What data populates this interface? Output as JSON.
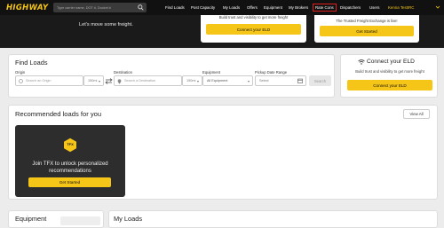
{
  "nav": {
    "logo": "HIGHWAY",
    "search_placeholder": "Type carrier name, DOT #, Docket #",
    "links": [
      "Find Loads",
      "Post Capacity",
      "My Loads",
      "Offers",
      "Equipment",
      "My Brokers",
      "Rate Cons",
      "Dispatchers",
      "Users"
    ],
    "user": "Kenna TestIRC"
  },
  "hero": {
    "tagline": "Let's move some freight."
  },
  "hero_cards": [
    {
      "text": "Build trust and visibility to get more freight",
      "button": "Connect your ELD"
    },
    {
      "text": "The Trusted Freight Exchange is live!",
      "button": "Get Started"
    }
  ],
  "find_loads": {
    "title": "Find Loads",
    "origin": {
      "label": "Origin",
      "placeholder": "Search an Origin",
      "radius": "150mi"
    },
    "destination": {
      "label": "Destination",
      "placeholder": "Search a Destination",
      "radius": "150mi"
    },
    "equipment": {
      "label": "Equipment",
      "value": "All Equipment"
    },
    "pickup": {
      "label": "Pickup Date Range",
      "placeholder": "Select"
    },
    "search_button": "Search"
  },
  "eld": {
    "title": "Connect your ELD",
    "text": "Build trust and visibility to get more freight",
    "button": "Connect your ELD"
  },
  "recommended": {
    "title": "Recommended loads for you",
    "view_all": "View All",
    "badge": "TFX",
    "promo_text": "Join TFX to unlock personalized recommendations",
    "button": "Get Started"
  },
  "bottom": {
    "equipment_title": "Equipment",
    "my_loads_title": "My Loads"
  },
  "colors": {
    "accent": "#f5c518",
    "nav_bg": "#111111",
    "highlight": "#e02020"
  }
}
